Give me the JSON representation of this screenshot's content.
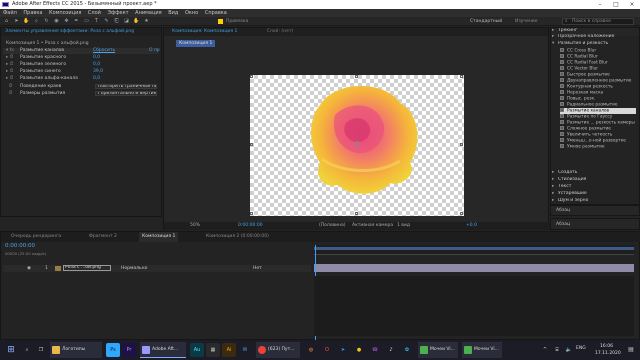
{
  "window": {
    "title": "Adobe After Effects CC 2015 - Безымянный проект.aep *"
  },
  "menu": [
    "Файл",
    "Правка",
    "Композиция",
    "Слой",
    "Эффект",
    "Анимация",
    "Вид",
    "Окно",
    "Справка"
  ],
  "toolbar": {
    "snapping": "Привязка",
    "workspace_default": "Стандартный",
    "workspace_learn": "Изучение",
    "search_placeholder": "Поиск в справке"
  },
  "effect_controls": {
    "tab_title": "Элементы управления эффектами: Роза с альфой.png",
    "breadcrumb": "Композиция 1 • Роза с альфой.png",
    "effect_name": "Размытие каналов",
    "reset_label": "Сбросить",
    "about_label": "О пр",
    "properties": [
      {
        "name": "Размытие красного",
        "value": "0,0"
      },
      {
        "name": "Размытие зеленого",
        "value": "0,0"
      },
      {
        "name": "Размытие синего",
        "value": "39,0"
      },
      {
        "name": "Размытие альфа-канала",
        "value": "0,0"
      }
    ],
    "edge_label": "Поведение краев",
    "edge_value": "Повторить граничные пик",
    "dims_label": "Размеры размытия",
    "dims_value": "Горизонтально и вертика"
  },
  "composition": {
    "tab_title": "Композиция: Композиция 1",
    "layer_tab": "Слой: (нет)",
    "flow_chip": "Композиция 1",
    "zoom": "50%",
    "timecode": "0:00:00:00",
    "resolution": "(Половина)",
    "camera": "Активная камера",
    "views": "1 вид",
    "exposure": "+0,0"
  },
  "effects_panel": {
    "categories_top": [
      "Трекинг",
      "Прозрачное наложение"
    ],
    "open_category": "Размытие и резкость",
    "items": [
      "CC Cross Blur",
      "CC Radial Blur",
      "CC Radial Fast Blur",
      "CC Vector Blur",
      "Быстрое размытие",
      "Двунаправленное размытие",
      "Контурная резкость",
      "Нерезкая маска",
      "Повыс. резк.",
      "Радиальное размытие",
      "Размытие каналов",
      "Размытие по Гауссу",
      "Размытие ... резкость камеры",
      "Сложное размытие",
      "Увеличить четкость",
      "Уменьш...о-ной развертке",
      "Умное размытие"
    ],
    "selected_index": 10,
    "categories_bottom": [
      "Создать",
      "Стилизация",
      "Текст",
      "Устаревшие",
      "Шум и зерно"
    ],
    "footer_panels": [
      "Абзац",
      "Абзац"
    ]
  },
  "timeline": {
    "tabs": [
      "Очередь рендеринга",
      "Фрагмент 2",
      "Композиция 1",
      "Композиция 2 (0:00:00:00)"
    ],
    "active_tab_index": 2,
    "timecode": "0:00:00:00",
    "fps": "00000 (25.00 кадр/с)",
    "layer": {
      "number": "1",
      "name": "Роза с ...ой.png",
      "mode": "Нормально",
      "parent": "Нет"
    }
  },
  "taskbar": {
    "search_label": "Логотипы",
    "windows": [
      "Adobe Aft...",
      "(623) Пут...",
      "Мочеи Vi...",
      "Мочеи Vi..."
    ],
    "time": "16:06",
    "date": "17.11.2020",
    "lang": "ENG"
  }
}
